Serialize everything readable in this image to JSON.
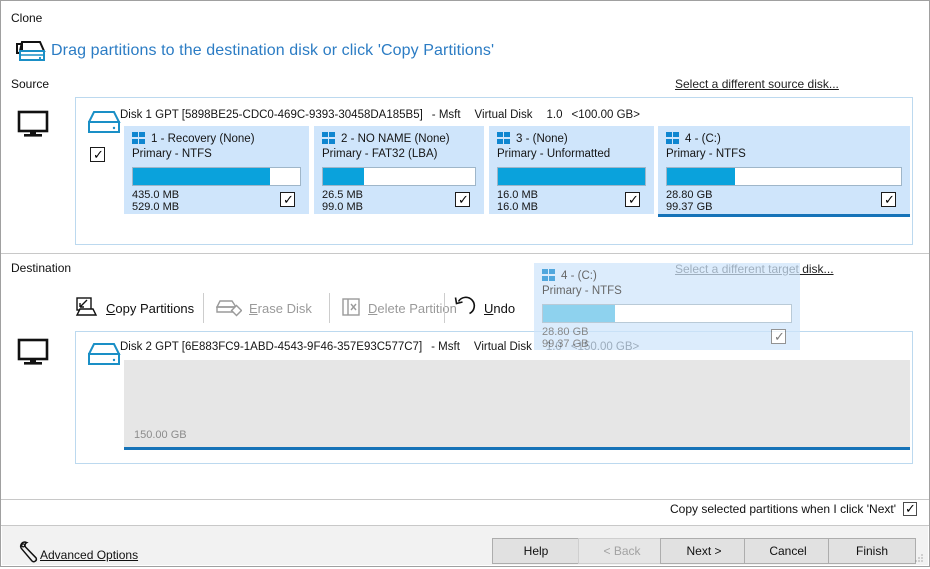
{
  "window": {
    "title": "Clone"
  },
  "headline": "Drag partitions to the destination disk or click 'Copy Partitions'",
  "sidebar": {
    "source_label": "Source",
    "source_icon": "disk-drag-icon",
    "source_monitor_icon": "monitor-icon",
    "dest_monitor_icon": "monitor-icon"
  },
  "source": {
    "section_label": "Source",
    "change_link": "Select a different source disk...",
    "disk": {
      "name": "Disk 1 GPT [5898BE25-CDC0-469C-9393-30458DA185B5]",
      "vendor": "- Msft",
      "model": "Virtual Disk",
      "revision": "1.0",
      "capacity": "<100.00 GB>",
      "checked": true
    },
    "partitions": [
      {
        "header": "1 - Recovery (None)",
        "subtitle": "Primary - NTFS",
        "used": "435.0 MB",
        "total": "529.0 MB",
        "fill_percent": 82,
        "checked": true,
        "selected": false
      },
      {
        "header": "2 - NO NAME (None)",
        "subtitle": "Primary - FAT32 (LBA)",
        "used": "26.5 MB",
        "total": "99.0 MB",
        "fill_percent": 27,
        "checked": true,
        "selected": false
      },
      {
        "header": "3 -  (None)",
        "subtitle": "Primary - Unformatted",
        "used": "16.0 MB",
        "total": "16.0 MB",
        "fill_percent": 100,
        "checked": true,
        "selected": false
      },
      {
        "header": "4 -  (C:)",
        "subtitle": "Primary - NTFS",
        "used": "28.80 GB",
        "total": "99.37 GB",
        "fill_percent": 29,
        "checked": true,
        "selected": true
      }
    ]
  },
  "destination": {
    "section_label": "Destination",
    "change_link": "Select a different target disk...",
    "toolbar": [
      {
        "label": "Copy Partitions",
        "accel": "C",
        "icon": "copy-partitions-icon",
        "enabled": true
      },
      {
        "label": "Erase Disk",
        "accel": "E",
        "icon": "erase-disk-icon",
        "enabled": false
      },
      {
        "label": "Delete Partition",
        "accel": "D",
        "icon": "delete-partition-icon",
        "enabled": false
      },
      {
        "label": "Undo",
        "accel": "U",
        "icon": "undo-icon",
        "enabled": true
      }
    ],
    "disk": {
      "name": "Disk 2 GPT [6E883FC9-1ABD-4543-9F46-357E93C577C7]",
      "vendor": "- Msft",
      "model": "Virtual Disk",
      "revision": "1.0",
      "capacity": "<150.00 GB>",
      "unallocated_label": "150.00 GB"
    }
  },
  "drag_ghost": {
    "header": "4 -  (C:)",
    "subtitle": "Primary - NTFS",
    "used": "28.80 GB",
    "total": "99.37 GB",
    "fill_percent": 29,
    "checked": true
  },
  "footer": {
    "copy_on_next_label": "Copy selected partitions when I click 'Next'",
    "copy_on_next_checked": true,
    "advanced_options": "Advanced Options",
    "advanced_icon": "wrench-icon",
    "buttons": [
      {
        "label": "Help",
        "enabled": true
      },
      {
        "label": "< Back",
        "enabled": false
      },
      {
        "label": "Next >",
        "enabled": true
      },
      {
        "label": "Cancel",
        "enabled": true
      },
      {
        "label": "Finish",
        "enabled": true
      }
    ]
  },
  "colors": {
    "accent_link": "#2b7cc4",
    "partition_fill": "#0aa2dc",
    "partition_bg": "#cfe5fb",
    "selected_border": "#1673b8",
    "unallocated": "#e6e6e6"
  }
}
